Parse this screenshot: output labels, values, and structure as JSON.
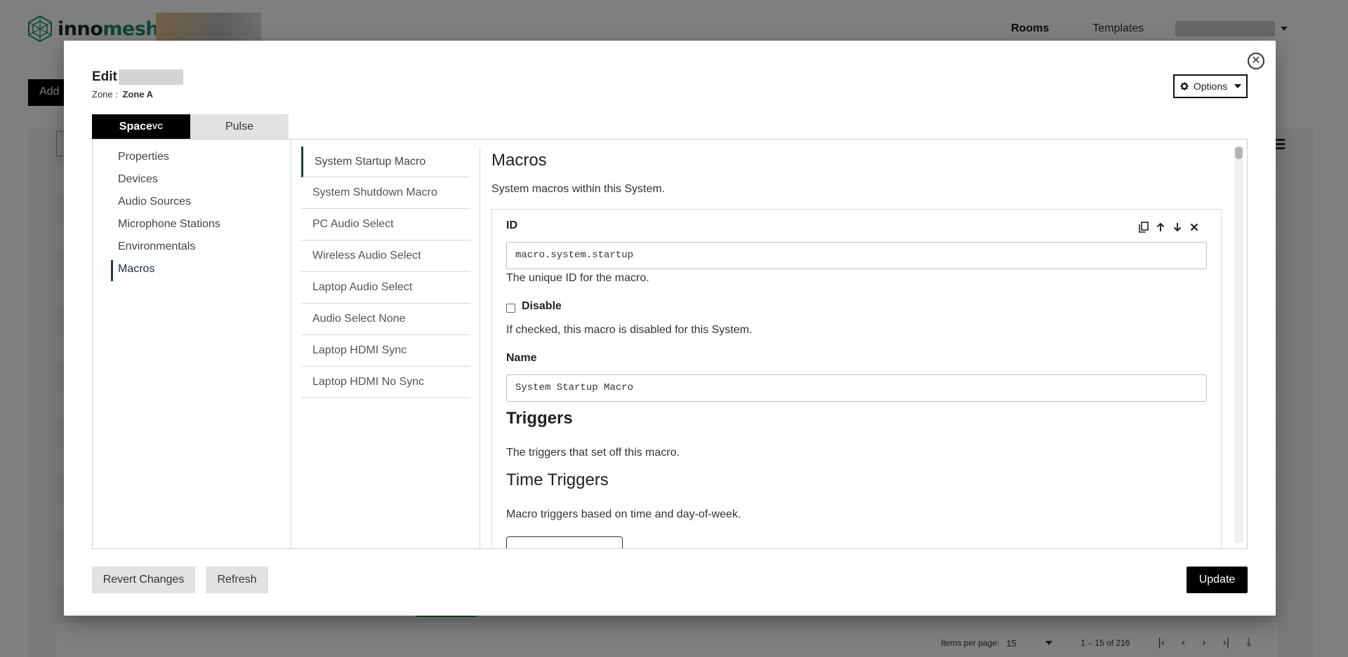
{
  "app": {
    "brand_part1": "inno",
    "brand_part2": "mesh",
    "nav": {
      "rooms": "Rooms",
      "templates": "Templates"
    },
    "add_label": "Add"
  },
  "pagination": {
    "items_per_page_label": "Items per page:",
    "items_per_page_value": "15",
    "range": "1 – 15 of 216"
  },
  "modal": {
    "title": "Edit",
    "zone_label": "Zone :",
    "zone_value": "Zone A",
    "options_label": "Options",
    "tabs": [
      {
        "label": "Space",
        "sup": "VC"
      },
      {
        "label": "Pulse"
      }
    ],
    "left_nav": [
      "Properties",
      "Devices",
      "Audio Sources",
      "Microphone Stations",
      "Environmentals",
      "Macros"
    ],
    "macros": [
      "System Startup Macro",
      "System Shutdown Macro",
      "PC Audio Select",
      "Wireless Audio Select",
      "Laptop Audio Select",
      "Audio Select None",
      "Laptop HDMI Sync",
      "Laptop HDMI No Sync"
    ],
    "content": {
      "heading": "Macros",
      "description": "System macros within this System.",
      "id_label": "ID",
      "id_value": "macro.system.startup",
      "id_help": "The unique ID for the macro.",
      "disable_label": "Disable",
      "disable_help": "If checked, this macro is disabled for this System.",
      "name_label": "Name",
      "name_value": "System Startup Macro",
      "triggers_heading": "Triggers",
      "triggers_help": "The triggers that set off this macro.",
      "time_triggers_heading": "Time Triggers",
      "time_triggers_help": "Macro triggers based on time and day-of-week."
    },
    "footer": {
      "revert": "Revert Changes",
      "refresh": "Refresh",
      "update": "Update"
    }
  },
  "colors": {
    "brand_green": "#1f8a6f",
    "accent_dark": "#1c3f3a",
    "primary_button": "#000000"
  }
}
